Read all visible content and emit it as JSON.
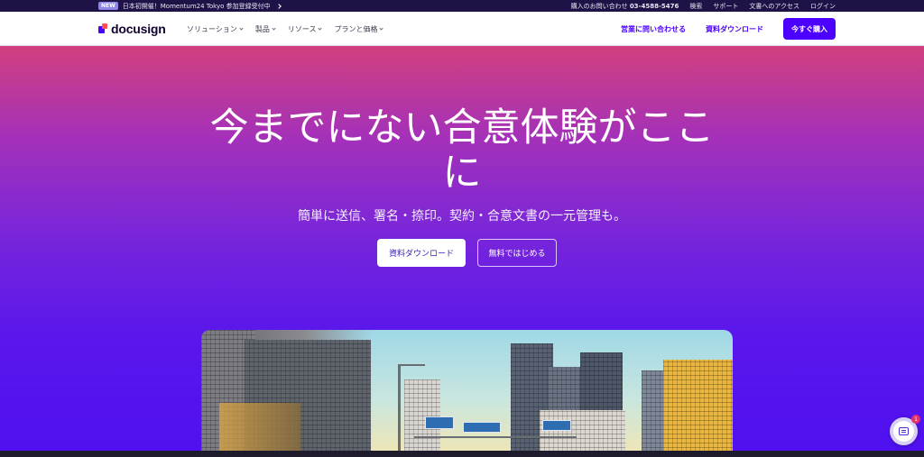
{
  "announcement": {
    "badge": "NEW",
    "text": "日本初開催！Momentum24 Tokyo 参加登録受付中"
  },
  "utility_nav": {
    "phone_label": "購入のお問い合わせ",
    "phone_number": "03-4588-5476",
    "search": "検索",
    "support": "サポート",
    "document_access": "文書へのアクセス",
    "login": "ログイン"
  },
  "nav": {
    "logo_text": "docusign",
    "menu": [
      "ソリューション",
      "製品",
      "リソース",
      "プランと価格"
    ],
    "contact_sales": "営業に問い合わせる",
    "download": "資料ダウンロード",
    "buy_now": "今すぐ購入"
  },
  "hero": {
    "title": "今までにない合意体験がここに",
    "subtitle": "簡単に送信、署名・捺印。契約・合意文書の一元管理も。",
    "primary_button": "資料ダウンロード",
    "secondary_button": "無料ではじめる"
  },
  "chat": {
    "unread_count": "1"
  },
  "colors": {
    "brand": "#4c00ff",
    "topbar": "#1e1247",
    "hero_top": "#d13f7e",
    "hero_bottom": "#4f10f0"
  }
}
